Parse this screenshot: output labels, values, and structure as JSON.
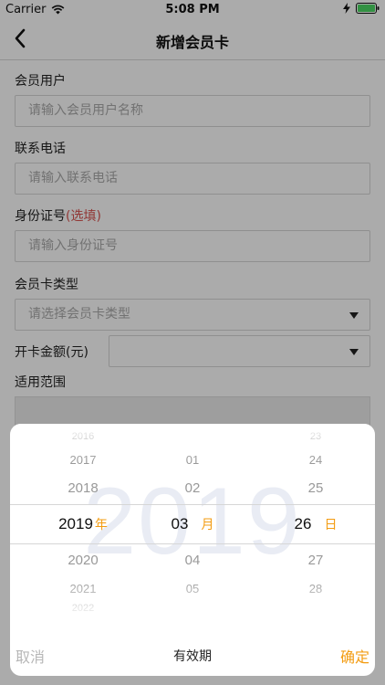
{
  "status_bar": {
    "carrier": "Carrier",
    "time": "5:08 PM"
  },
  "nav": {
    "title": "新增会员卡"
  },
  "form": {
    "member_user": {
      "label": "会员用户",
      "placeholder": "请输入会员用户名称"
    },
    "phone": {
      "label": "联系电话",
      "placeholder": "请输入联系电话"
    },
    "id_card": {
      "label": "身份证号",
      "optional": "(选填)",
      "placeholder": "请输入身份证号"
    },
    "card_type": {
      "label": "会员卡类型",
      "placeholder": "请选择会员卡类型"
    },
    "amount": {
      "label": "开卡金额(元)",
      "value": ""
    },
    "scope": {
      "label": "适用范围"
    }
  },
  "picker": {
    "watermark": "2019",
    "title": "有效期",
    "cancel_label": "取消",
    "confirm_label": "确定",
    "year": {
      "unit": "年",
      "above": [
        "2016",
        "2017",
        "2018"
      ],
      "selected": "2019",
      "below": [
        "2020",
        "2021",
        "2022"
      ]
    },
    "month": {
      "unit": "月",
      "above": [
        "01",
        "02"
      ],
      "selected": "03",
      "below": [
        "04",
        "05"
      ]
    },
    "day": {
      "unit": "日",
      "above": [
        "23",
        "24",
        "25"
      ],
      "selected": "26",
      "below": [
        "27",
        "28"
      ]
    }
  },
  "colors": {
    "accent": "#f39c12",
    "optional_tag": "#d9534f",
    "watermark": "#e9ecf4"
  }
}
